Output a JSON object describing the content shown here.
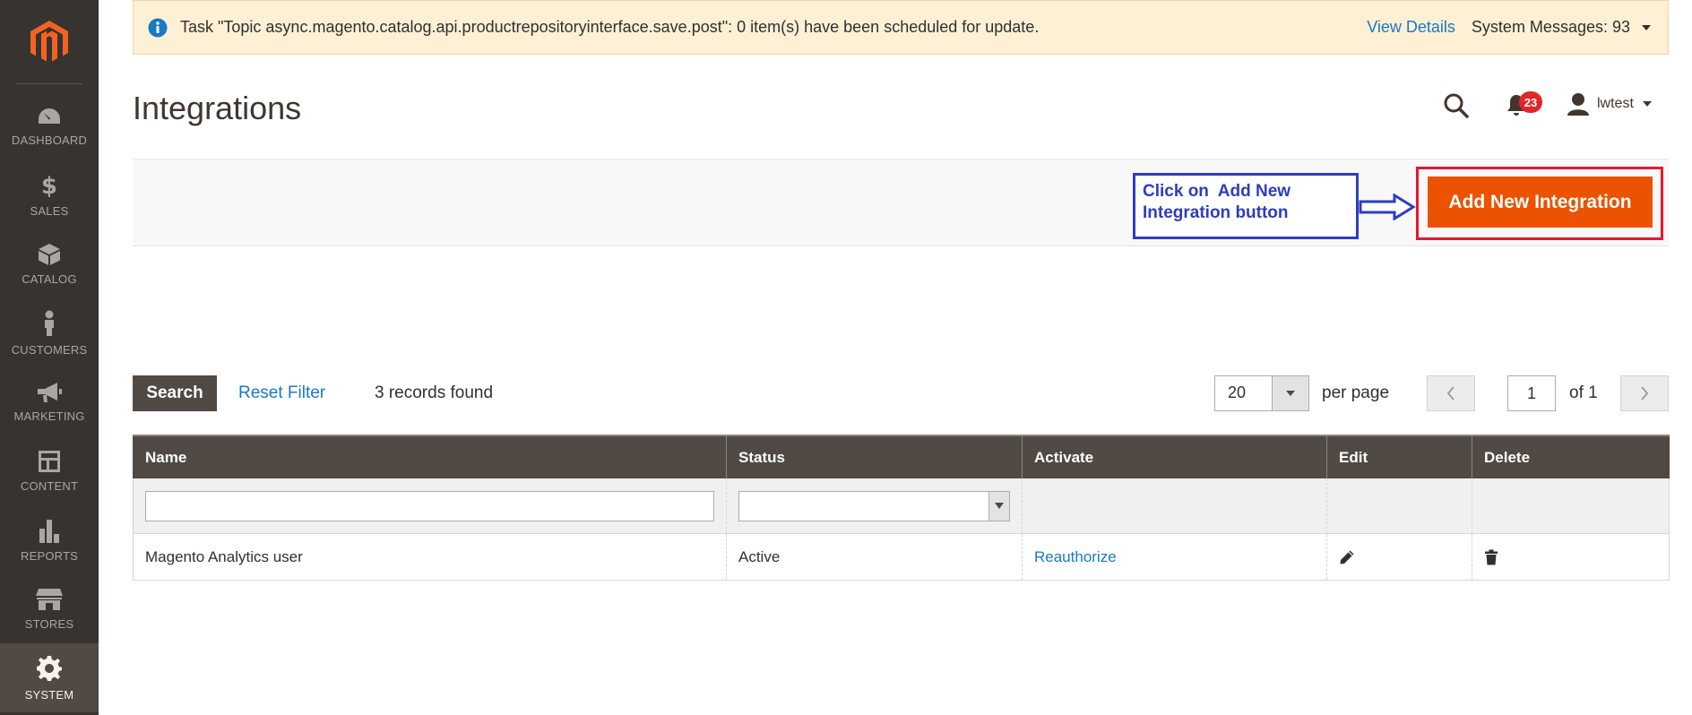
{
  "nav": {
    "items": [
      {
        "label": "DASHBOARD",
        "icon": "dashboard-icon"
      },
      {
        "label": "SALES",
        "icon": "dollar-icon"
      },
      {
        "label": "CATALOG",
        "icon": "box-icon"
      },
      {
        "label": "CUSTOMERS",
        "icon": "person-icon"
      },
      {
        "label": "MARKETING",
        "icon": "megaphone-icon"
      },
      {
        "label": "CONTENT",
        "icon": "layout-icon"
      },
      {
        "label": "REPORTS",
        "icon": "bar-chart-icon"
      },
      {
        "label": "STORES",
        "icon": "storefront-icon"
      },
      {
        "label": "SYSTEM",
        "icon": "gear-icon"
      }
    ],
    "active": "SYSTEM"
  },
  "message_bar": {
    "text": "Task \"Topic async.magento.catalog.api.productrepositoryinterface.save.post\": 0 item(s) have been scheduled for update.",
    "view_details": "View Details",
    "system_messages": "System Messages: 93"
  },
  "header": {
    "title": "Integrations",
    "notification_count": "23",
    "username": "lwtest"
  },
  "actions": {
    "callout_text": "Click on  Add New\nIntegration button",
    "add_button": "Add New Integration"
  },
  "grid_controls": {
    "search_button": "Search",
    "reset_filter": "Reset Filter",
    "records_found": "3 records found",
    "per_page_value": "20",
    "per_page_label": "per page",
    "current_page": "1",
    "of_pages": "of 1"
  },
  "table": {
    "columns": [
      "Name",
      "Status",
      "Activate",
      "Edit",
      "Delete"
    ],
    "rows": [
      {
        "name": "Magento Analytics user",
        "status": "Active",
        "activate": "Reauthorize"
      }
    ]
  },
  "colors": {
    "sidebar": "#373330",
    "accent": "#eb5202",
    "link": "#1979c3",
    "callout": "#2e3dbf",
    "highlight_frame": "#e3192e"
  }
}
